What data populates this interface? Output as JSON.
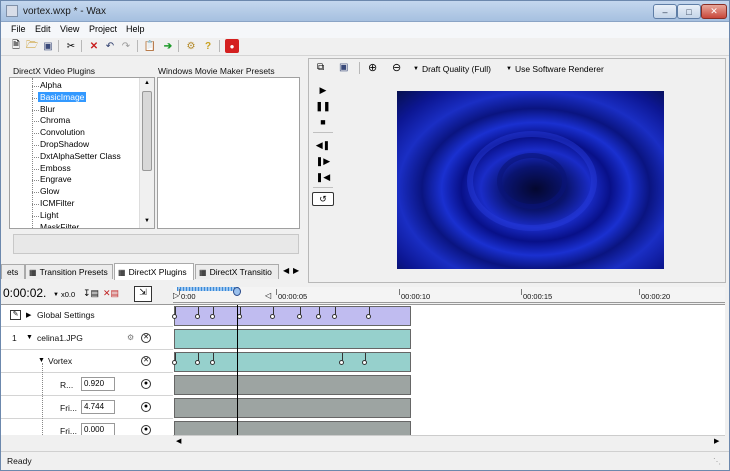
{
  "title": "vortex.wxp * - Wax",
  "menu": [
    "File",
    "Edit",
    "View",
    "Project",
    "Help"
  ],
  "plugins": {
    "header_left": "DirectX Video Plugins",
    "header_right": "Windows Movie Maker Presets",
    "items": [
      "Alpha",
      "BasicImage",
      "Blur",
      "Chroma",
      "Convolution",
      "DropShadow",
      "DxtAlphaSetter Class",
      "Emboss",
      "Engrave",
      "Glow",
      "ICMFilter",
      "Light",
      "MaskFilter"
    ],
    "selected": "BasicImage"
  },
  "tabs": [
    "ets",
    "Transition Presets",
    "DirectX Plugins",
    "DirectX Transitio"
  ],
  "preview": {
    "quality_label": "Draft Quality (Full)",
    "renderer_label": "Use Software Renderer"
  },
  "timeline": {
    "time_display": "0:00:02.",
    "speed_label": "x0.0",
    "ruler_ticks": [
      "0:00",
      "00:00:05",
      "00:00:10",
      "00:00:15",
      "00:00:20"
    ],
    "rows": {
      "global_settings": "Global Settings",
      "track_number": "1",
      "track_name": "celina1.JPG",
      "effect_name": "Vortex",
      "params": [
        {
          "label": "R...",
          "value": "0.920"
        },
        {
          "label": "Fri...",
          "value": "4.744"
        },
        {
          "label": "Fri...",
          "value": "0.000"
        }
      ]
    }
  },
  "status": "Ready",
  "colors": {
    "purple_track": "#c0bcf0",
    "teal_track": "#96d0cc",
    "gray_track": "#9da4a2",
    "selection": "#3399ff"
  }
}
